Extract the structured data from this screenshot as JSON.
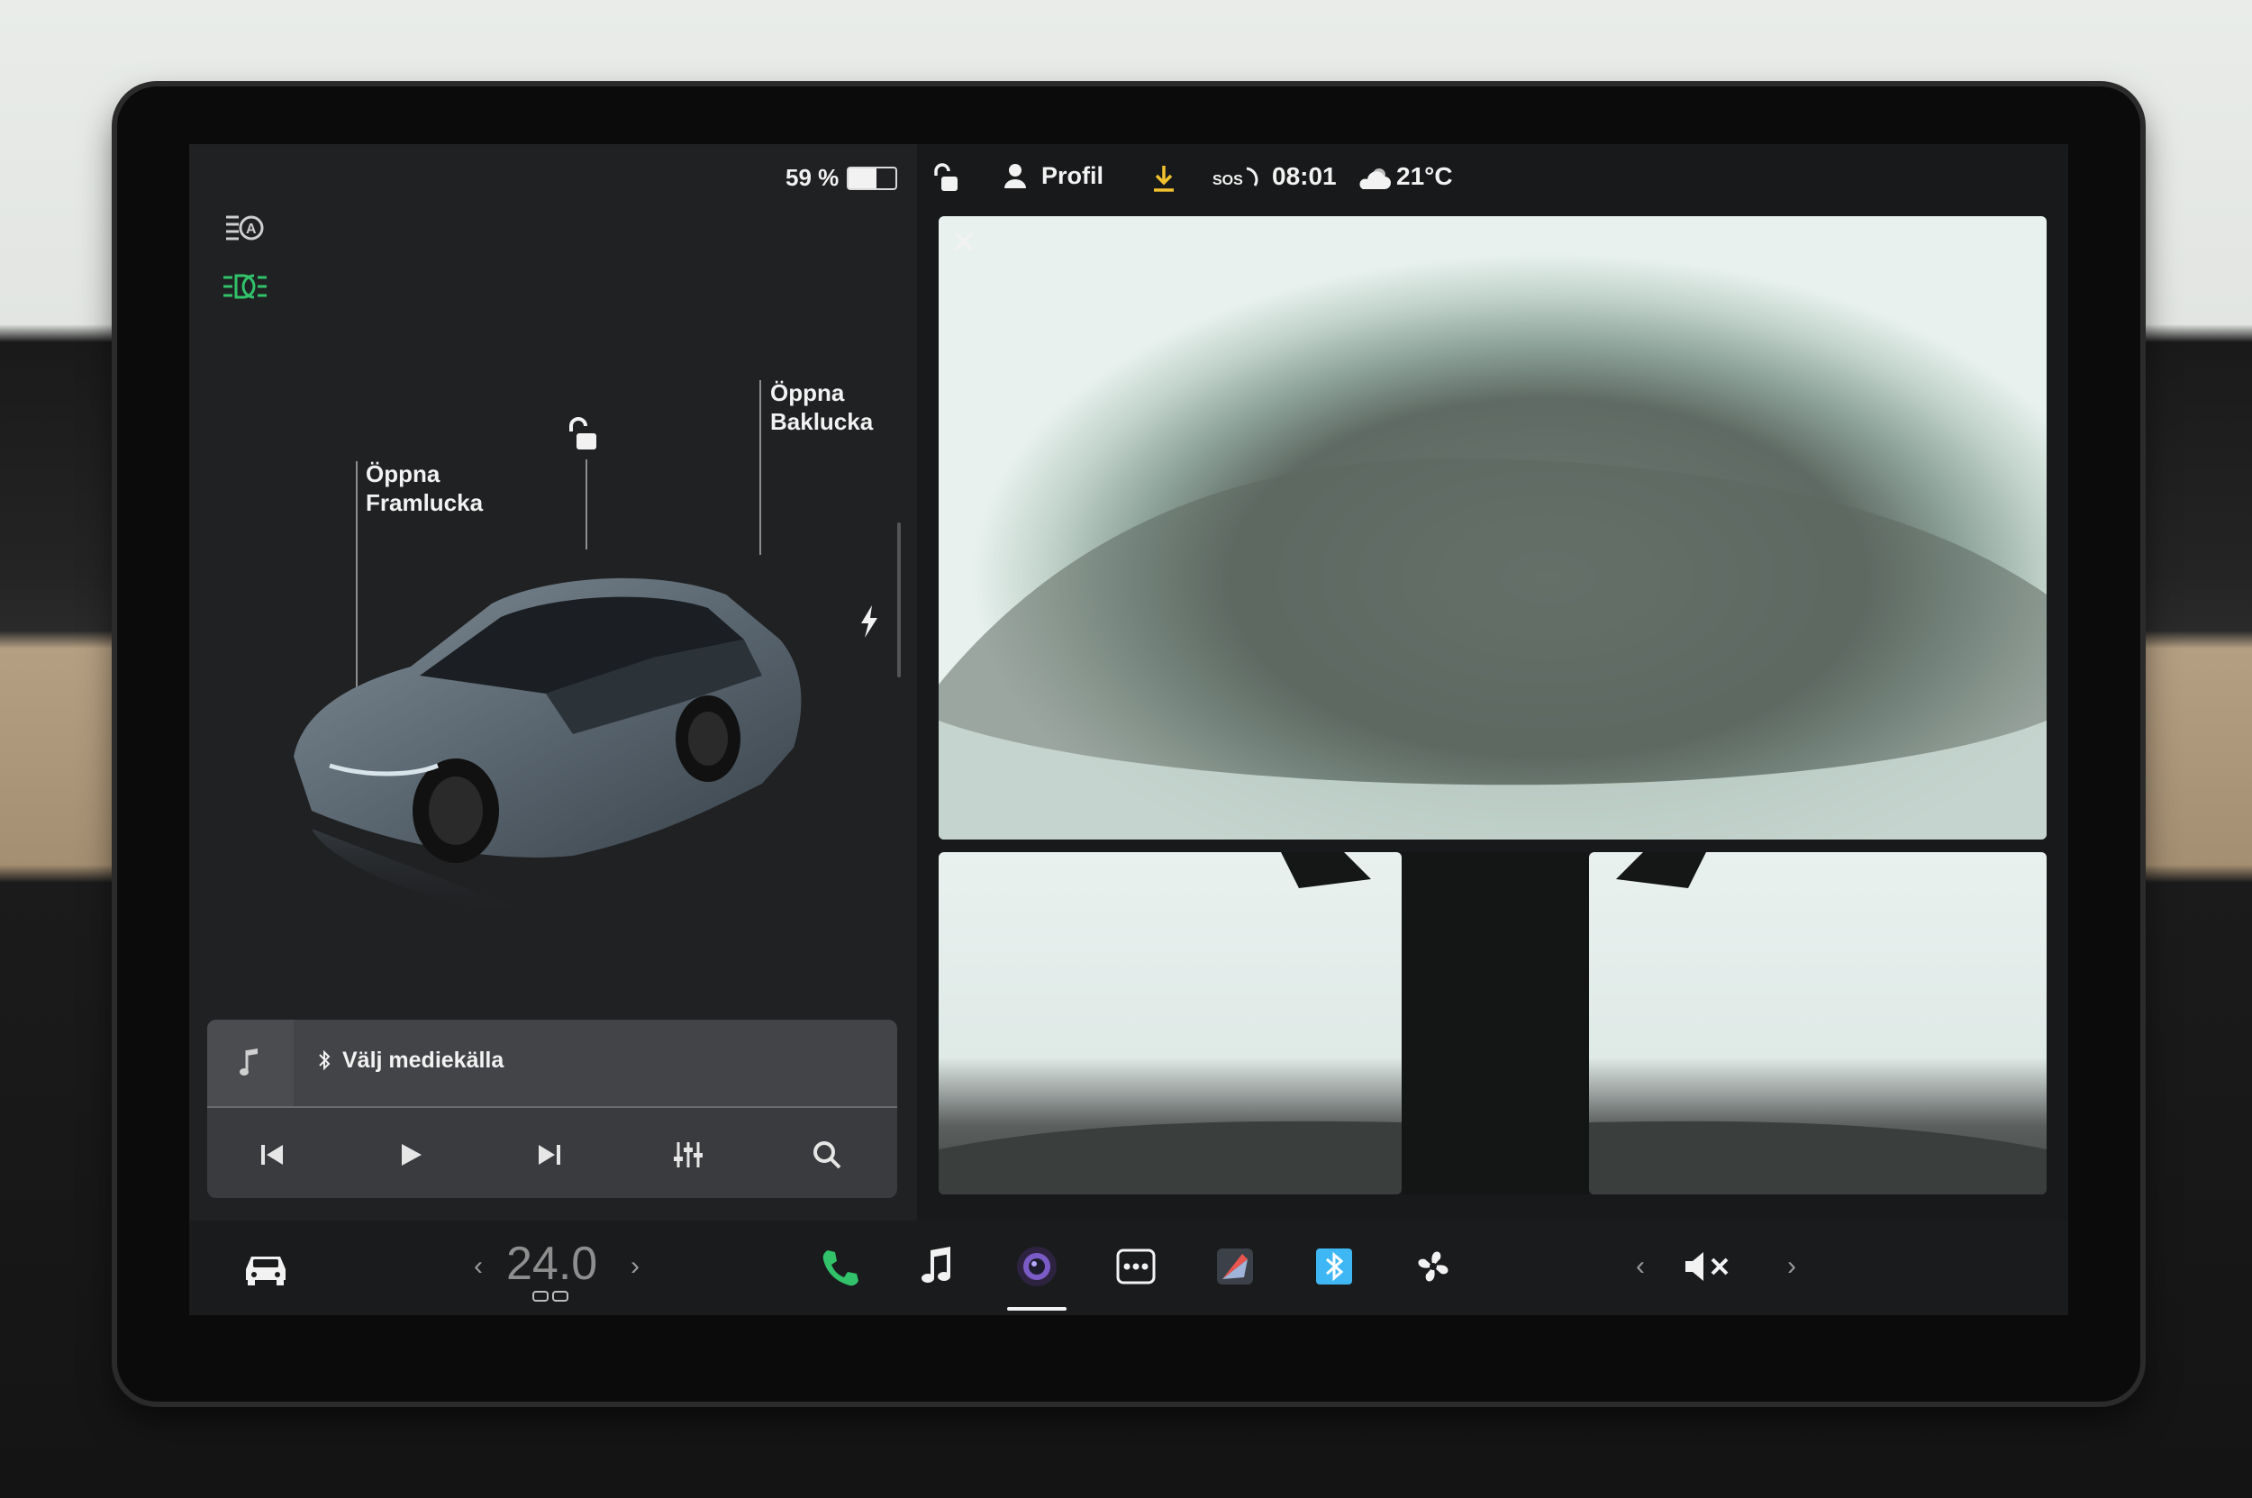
{
  "status_bar": {
    "battery_percent": "59 %",
    "battery_level": 0.59,
    "profile_label": "Profil",
    "sos_label": "SOS",
    "time": "08:01",
    "temperature": "21°C"
  },
  "car_view": {
    "frunk_label": "Öppna\nFramlucka",
    "trunk_label": "Öppna\nBaklucka"
  },
  "media": {
    "source_label": "Välj mediekälla"
  },
  "dock": {
    "temperature_value": "24.0",
    "volume_state": "muted"
  },
  "colors": {
    "accent_green": "#31c26a",
    "download_yellow": "#f2c12e",
    "bluetooth_blue": "#3fb7f4"
  }
}
